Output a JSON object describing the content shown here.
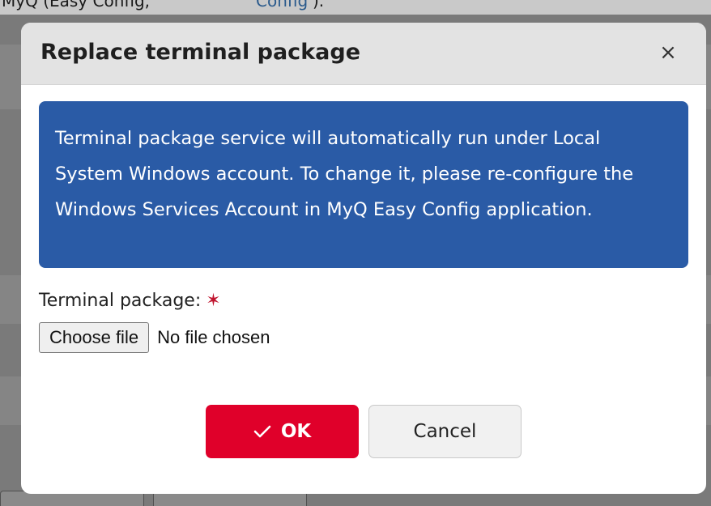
{
  "background": {
    "top_text_prefix": "MyQ (Easy Config,",
    "top_text_link": "Config",
    "top_text_suffix": ")."
  },
  "dialog": {
    "title": "Replace terminal package",
    "close_symbol": "×",
    "info_message": "Terminal package service will automatically run under Local System Windows account. To change it, please re-configure the Windows Services Account in MyQ Easy Config application.",
    "field_label": "Terminal package:",
    "required_marker": "✶",
    "file_button_label": "Choose file",
    "file_status": "No file chosen",
    "ok_label": "OK",
    "cancel_label": "Cancel"
  },
  "colors": {
    "info_background": "#2a5ba6",
    "ok_background": "#e0002a",
    "required_star": "#c0152f",
    "header_background": "#e3e3e3"
  },
  "icons": {
    "close": "close-icon",
    "ok": "check-icon"
  }
}
